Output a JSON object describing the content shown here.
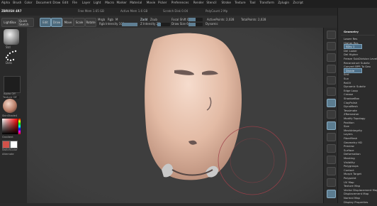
{
  "menubar": {
    "items": [
      "Alpha",
      "Brush",
      "Color",
      "Document",
      "Draw",
      "Edit",
      "File",
      "Layer",
      "Light",
      "Macro",
      "Marker",
      "Material",
      "Movie",
      "Picker",
      "Preferences",
      "Render",
      "Stencil",
      "Stroke",
      "Texture",
      "Tool",
      "Transform",
      "Zplugin",
      "Zscript"
    ]
  },
  "statusbar": {
    "app_name": "ZBRUSH 4R7",
    "items": [
      "Free Mem 1.65 GB",
      "Active Mem 1.6 GB",
      "Scratch Disk 0.04",
      "PolyCount 2 Mp"
    ]
  },
  "topbar": {
    "lightbox_label": "LightBox",
    "quick_sketch_label": "Quick Sketch",
    "edit_label": "Edit",
    "draw_label": "Draw",
    "move_label": "Move",
    "scale_label": "Scale",
    "rotate_label": "Rotate",
    "mrgb_label": "Mrgb",
    "rgb_label": "Rgb",
    "m_label": "M",
    "rgb_intensity_label": "Rgb Intensity 100",
    "zadd_label": "Zadd",
    "zsub_label": "Zsub",
    "z_intensity_label": "Z Intensity 25",
    "focal_shift_label": "Focal Shift 0",
    "draw_size_label": "Draw Size 64",
    "dynamic_label": "Dynamic",
    "active_points_label": "ActivePoints: 2,028",
    "total_points_label": "TotalPoints: 2,028",
    "rgb_intensity": 100,
    "z_intensity": 25,
    "draw_size": 64
  },
  "lefttray": {
    "brush_label": "Std",
    "stroke_label": "Dots",
    "alpha_label": "Alpha Off",
    "texture_label": "Texture Off",
    "material_label": "SkinShade4",
    "gradient_label": "Gradient",
    "switch_color_label": "SwitchColor",
    "alternate_label": "Alternate"
  },
  "rightpanel": {
    "title": "Geometry",
    "items": [
      {
        "label": "Lower Res",
        "highlight": false
      },
      {
        "label": "Higher Res",
        "highlight": false
      },
      {
        "label": "SDiv 1",
        "highlight": true
      },
      {
        "label": "Del Lower",
        "highlight": false
      },
      {
        "label": "Del Higher",
        "highlight": false
      },
      {
        "label": "Freeze SubDivision Levels",
        "highlight": false
      },
      {
        "label": "Reconstruct Subdiv",
        "highlight": false
      },
      {
        "label": "Convert BPR To Geo",
        "highlight": false
      },
      {
        "label": "Divide",
        "highlight": true
      },
      {
        "label": "Smt",
        "highlight": false
      },
      {
        "label": "Suv",
        "highlight": false
      },
      {
        "label": "ReUV",
        "highlight": false
      },
      {
        "label": "Dynamic Subdiv",
        "highlight": false
      },
      {
        "label": "Edge Loop",
        "highlight": false
      },
      {
        "label": "Crease",
        "highlight": false
      },
      {
        "label": "ShadowBox",
        "highlight": false
      },
      {
        "label": "ClayPolish",
        "highlight": false
      },
      {
        "label": "DynaMesh",
        "highlight": false
      },
      {
        "label": "Tessimate",
        "highlight": false
      },
      {
        "label": "ZRemesher",
        "highlight": false
      },
      {
        "label": "Modify Topology",
        "highlight": false
      },
      {
        "label": "Position",
        "highlight": false
      },
      {
        "label": "Size",
        "highlight": false
      },
      {
        "label": "MeshIntegrity",
        "highlight": false
      },
      {
        "label": "Layers",
        "highlight": false
      },
      {
        "label": "FiberMesh",
        "highlight": false
      },
      {
        "label": "Geometry HD",
        "highlight": false
      },
      {
        "label": "Preview",
        "highlight": false
      },
      {
        "label": "Surface",
        "highlight": false
      },
      {
        "label": "Deformation",
        "highlight": false
      },
      {
        "label": "Masking",
        "highlight": false
      },
      {
        "label": "Visibility",
        "highlight": false
      },
      {
        "label": "Polygroups",
        "highlight": false
      },
      {
        "label": "Contact",
        "highlight": false
      },
      {
        "label": "Morph Target",
        "highlight": false
      },
      {
        "label": "Polypaint",
        "highlight": false
      },
      {
        "label": "UV Map",
        "highlight": false
      },
      {
        "label": "Texture Map",
        "highlight": false
      },
      {
        "label": "Vector Displacement Map",
        "highlight": false
      },
      {
        "label": "Displacement Map",
        "highlight": false
      },
      {
        "label": "Normal Map",
        "highlight": false
      },
      {
        "label": "Display Properties",
        "highlight": false
      }
    ]
  },
  "colors": {
    "accent": "#5f7f94",
    "skin": "#e6c2ad",
    "brush_cursor": "#a0404a",
    "primary_color": "#d2524a",
    "secondary_color": "#ffffff"
  }
}
